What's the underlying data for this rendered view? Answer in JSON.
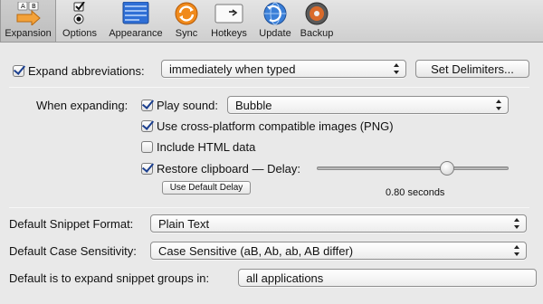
{
  "toolbar": {
    "items": [
      {
        "label": "Expansion",
        "icon": "expansion-keys-icon"
      },
      {
        "label": "Options",
        "icon": "options-checkbox-radio-icon"
      },
      {
        "label": "Appearance",
        "icon": "appearance-window-icon"
      },
      {
        "label": "Sync",
        "icon": "sync-icon"
      },
      {
        "label": "Hotkeys",
        "icon": "hotkeys-keyboard-icon"
      },
      {
        "label": "Update",
        "icon": "update-globe-icon"
      },
      {
        "label": "Backup",
        "icon": "backup-disk-icon"
      }
    ],
    "selected": "Expansion"
  },
  "expand": {
    "label": "Expand abbreviations:",
    "checked": true,
    "mode": "immediately when typed",
    "delimiters_button": "Set Delimiters..."
  },
  "when_expanding": {
    "label": "When expanding:",
    "play_sound": {
      "label": "Play sound:",
      "checked": true,
      "value": "Bubble"
    },
    "cross_platform": {
      "label": "Use cross-platform compatible images (PNG)",
      "checked": true
    },
    "include_html": {
      "label": "Include HTML data",
      "checked": false
    },
    "restore_clipboard": {
      "label": "Restore clipboard — Delay:",
      "checked": true,
      "delay_fraction": 0.68
    },
    "default_delay_button": "Use Default Delay",
    "delay_value": "0.80 seconds"
  },
  "snippet_format": {
    "label": "Default Snippet Format:",
    "value": "Plain Text"
  },
  "case_sensitivity": {
    "label": "Default Case Sensitivity:",
    "value": "Case Sensitive (aB, Ab, ab, AB differ)"
  },
  "expand_groups": {
    "label": "Default is to expand snippet groups in:",
    "value": "all applications"
  },
  "colors": {
    "check_blue": "#1b3f8f",
    "sync_orange": "#f08a1c",
    "appearance_blue": "#2f6fd6"
  }
}
